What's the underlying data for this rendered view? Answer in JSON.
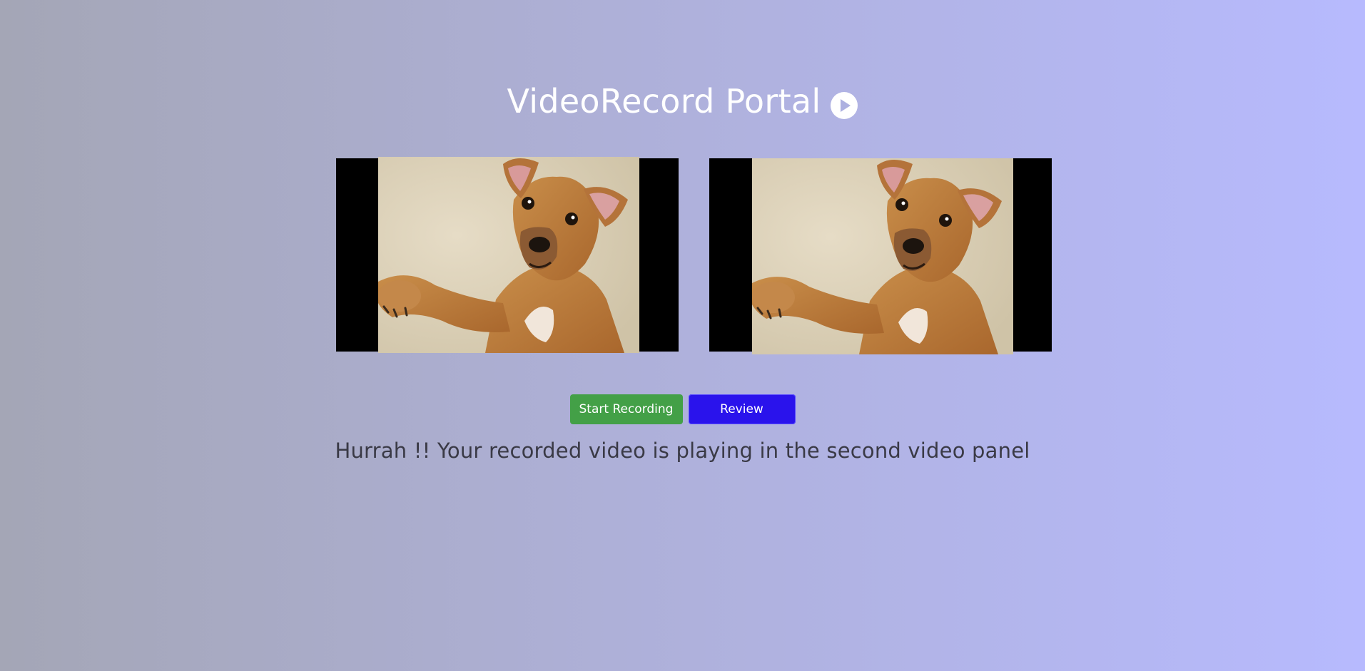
{
  "header": {
    "title": "VideoRecord Portal",
    "icon": "play-circle-icon"
  },
  "videos": [
    {
      "name": "live-camera-panel",
      "content": "dog photo"
    },
    {
      "name": "recorded-playback-panel",
      "content": "dog photo"
    }
  ],
  "controls": {
    "start_label": "Start Recording",
    "review_label": "Review"
  },
  "status": {
    "message": "Hurrah !! Your recorded video is playing in the second video panel"
  },
  "colors": {
    "start_button": "#43a047",
    "review_button": "#2a13ec",
    "video_background": "#000000",
    "title_text": "#ffffff",
    "status_text": "#3a3a46"
  }
}
